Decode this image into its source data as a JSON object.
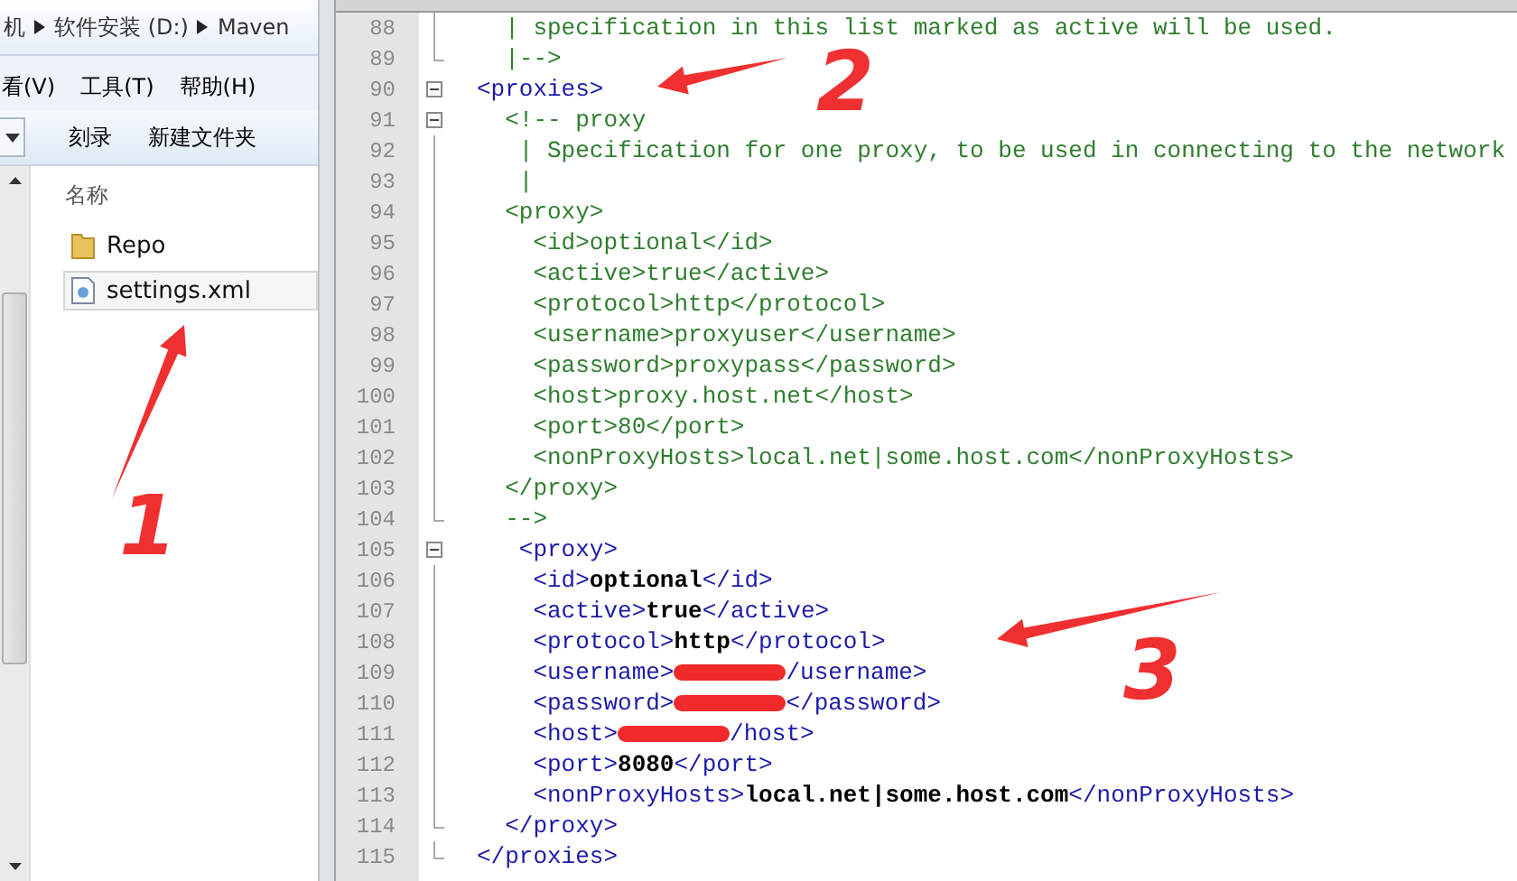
{
  "explorer": {
    "breadcrumb": [
      {
        "label": "机"
      },
      {
        "label": "软件安装 (D:)"
      },
      {
        "label": "Maven"
      }
    ],
    "menu": [
      {
        "label": "看(V)"
      },
      {
        "label": "工具(T)"
      },
      {
        "label": "帮助(H)"
      }
    ],
    "toolbar": [
      {
        "label": "刻录"
      },
      {
        "label": "新建文件夹"
      }
    ],
    "column_header": "名称",
    "files": [
      {
        "name": "Repo",
        "kind": "folder",
        "selected": false
      },
      {
        "name": "settings.xml",
        "kind": "xml",
        "selected": true
      }
    ]
  },
  "editor": {
    "lines": [
      {
        "number": "88",
        "fold": {
          "kind": "line"
        },
        "segments": [
          {
            "kind": "comment",
            "text": "  | specification in this list marked as active will be used."
          }
        ]
      },
      {
        "number": "89",
        "fold": {
          "kind": "end"
        },
        "segments": [
          {
            "kind": "comment",
            "text": "  |-->"
          }
        ]
      },
      {
        "number": "90",
        "fold": {
          "kind": "box"
        },
        "segments": [
          {
            "kind": "tag",
            "text": "<proxies>"
          }
        ]
      },
      {
        "number": "91",
        "fold": {
          "kind": "box"
        },
        "segments": [
          {
            "kind": "comment",
            "text": "  <!-- proxy"
          }
        ]
      },
      {
        "number": "92",
        "fold": {
          "kind": "line"
        },
        "segments": [
          {
            "kind": "comment",
            "text": "   | Specification for one proxy, to be used in connecting to the network"
          }
        ]
      },
      {
        "number": "93",
        "fold": {
          "kind": "line"
        },
        "segments": [
          {
            "kind": "comment",
            "text": "   |"
          }
        ]
      },
      {
        "number": "94",
        "fold": {
          "kind": "line"
        },
        "segments": [
          {
            "kind": "comment",
            "text": "  <proxy>"
          }
        ]
      },
      {
        "number": "95",
        "fold": {
          "kind": "line"
        },
        "segments": [
          {
            "kind": "comment",
            "text": "    <id>optional</id>"
          }
        ]
      },
      {
        "number": "96",
        "fold": {
          "kind": "line"
        },
        "segments": [
          {
            "kind": "comment",
            "text": "    <active>true</active>"
          }
        ]
      },
      {
        "number": "97",
        "fold": {
          "kind": "line"
        },
        "segments": [
          {
            "kind": "comment",
            "text": "    <protocol>http</protocol>"
          }
        ]
      },
      {
        "number": "98",
        "fold": {
          "kind": "line"
        },
        "segments": [
          {
            "kind": "comment",
            "text": "    <username>proxyuser</username>"
          }
        ]
      },
      {
        "number": "99",
        "fold": {
          "kind": "line"
        },
        "segments": [
          {
            "kind": "comment",
            "text": "    <password>proxypass</password>"
          }
        ]
      },
      {
        "number": "100",
        "fold": {
          "kind": "line"
        },
        "segments": [
          {
            "kind": "comment",
            "text": "    <host>proxy.host.net</host>"
          }
        ]
      },
      {
        "number": "101",
        "fold": {
          "kind": "line"
        },
        "segments": [
          {
            "kind": "comment",
            "text": "    <port>80</port>"
          }
        ]
      },
      {
        "number": "102",
        "fold": {
          "kind": "line"
        },
        "segments": [
          {
            "kind": "comment",
            "text": "    <nonProxyHosts>local.net|some.host.com</nonProxyHosts>"
          }
        ]
      },
      {
        "number": "103",
        "fold": {
          "kind": "line"
        },
        "segments": [
          {
            "kind": "comment",
            "text": "  </proxy>"
          }
        ]
      },
      {
        "number": "104",
        "fold": {
          "kind": "end"
        },
        "segments": [
          {
            "kind": "comment",
            "text": "  -->"
          }
        ]
      },
      {
        "number": "105",
        "fold": {
          "kind": "box"
        },
        "segments": [
          {
            "kind": "tag",
            "text": "   <proxy>"
          }
        ]
      },
      {
        "number": "106",
        "fold": {
          "kind": "line"
        },
        "segments": [
          {
            "kind": "tag",
            "text": "    <id>"
          },
          {
            "kind": "text",
            "text": "optional"
          },
          {
            "kind": "tag",
            "text": "</id>"
          }
        ]
      },
      {
        "number": "107",
        "fold": {
          "kind": "line"
        },
        "segments": [
          {
            "kind": "tag",
            "text": "    <active>"
          },
          {
            "kind": "text",
            "text": "true"
          },
          {
            "kind": "tag",
            "text": "</active>"
          }
        ]
      },
      {
        "number": "108",
        "fold": {
          "kind": "line"
        },
        "segments": [
          {
            "kind": "tag",
            "text": "    <protocol>"
          },
          {
            "kind": "text",
            "text": "http"
          },
          {
            "kind": "tag",
            "text": "</protocol>"
          }
        ]
      },
      {
        "number": "109",
        "fold": {
          "kind": "line"
        },
        "segments": [
          {
            "kind": "tag",
            "text": "    <username>"
          },
          {
            "kind": "redacted"
          },
          {
            "kind": "tag",
            "text": "/username>"
          }
        ]
      },
      {
        "number": "110",
        "fold": {
          "kind": "line"
        },
        "segments": [
          {
            "kind": "tag",
            "text": "    <password>"
          },
          {
            "kind": "redacted"
          },
          {
            "kind": "tag",
            "text": "</password>"
          }
        ]
      },
      {
        "number": "111",
        "fold": {
          "kind": "line"
        },
        "segments": [
          {
            "kind": "tag",
            "text": "    <host>"
          },
          {
            "kind": "redacted"
          },
          {
            "kind": "tag",
            "text": "/host>"
          }
        ]
      },
      {
        "number": "112",
        "fold": {
          "kind": "line"
        },
        "segments": [
          {
            "kind": "tag",
            "text": "    <port>"
          },
          {
            "kind": "text",
            "text": "8080"
          },
          {
            "kind": "tag",
            "text": "</port>"
          }
        ]
      },
      {
        "number": "113",
        "fold": {
          "kind": "line"
        },
        "segments": [
          {
            "kind": "tag",
            "text": "    <nonProxyHosts>"
          },
          {
            "kind": "text",
            "text": "local.net|some.host.com"
          },
          {
            "kind": "tag",
            "text": "</nonProxyHosts>"
          }
        ]
      },
      {
        "number": "114",
        "fold": {
          "kind": "end"
        },
        "segments": [
          {
            "kind": "tag",
            "text": "  </proxy>"
          }
        ]
      },
      {
        "number": "115",
        "fold": {
          "kind": "end"
        },
        "segments": [
          {
            "kind": "tag",
            "text": "</proxies>"
          }
        ]
      }
    ]
  },
  "annotations": [
    {
      "label": "1"
    },
    {
      "label": "2"
    },
    {
      "label": "3"
    }
  ]
}
